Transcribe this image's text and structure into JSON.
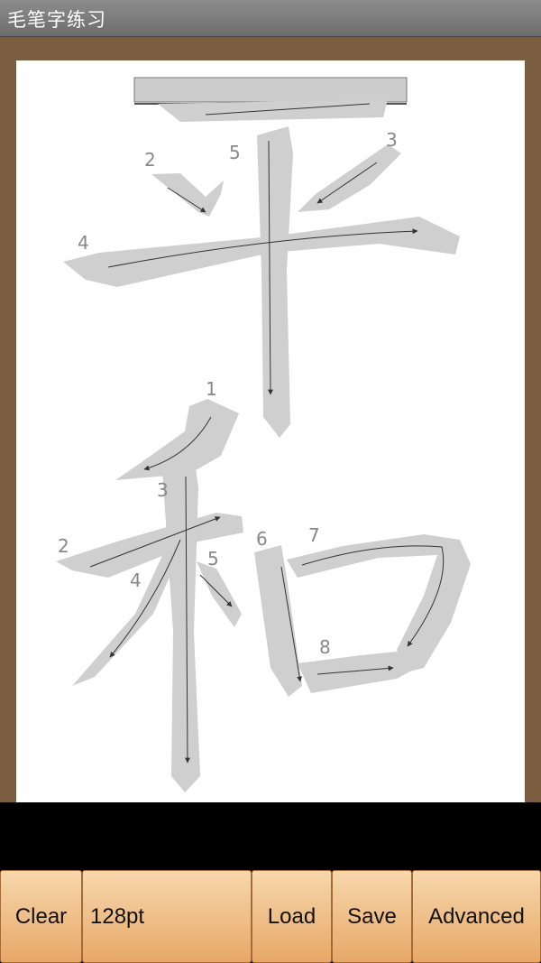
{
  "app": {
    "title": "毛笔字练习"
  },
  "guide": {
    "stroke_numbers": {
      "ping": [
        "2",
        "5",
        "3",
        "4"
      ],
      "he": [
        "1",
        "3",
        "2",
        "5",
        "4",
        "6",
        "7",
        "8"
      ]
    }
  },
  "toolbar": {
    "clear_label": "Clear",
    "size_label": "128pt",
    "load_label": "Load",
    "save_label": "Save",
    "advanced_label": "Advanced"
  },
  "colors": {
    "frame": "#7b5d40",
    "paper": "#ffffff",
    "stroke_guide": "#cfcfcf",
    "button_top": "#f7d7ad",
    "button_bottom": "#e7a866"
  }
}
